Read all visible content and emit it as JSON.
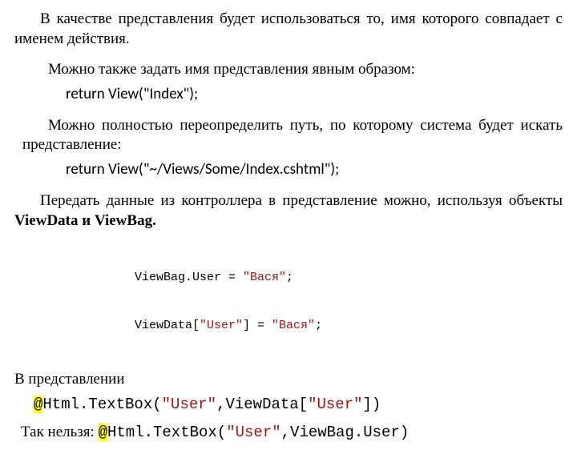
{
  "p1": "В качестве представления будет использоваться то, имя которого совпадает с именем действия.",
  "p2": "Можно также задать имя представления явным образом:",
  "c1_a": "return  View(",
  "c1_s": "\"Index\"",
  "c1_b": ");",
  "p3": "Можно полностью переопределить путь, по которому система будет искать представление:",
  "c2_a": "return View(",
  "c2_s": "\"~/Views/Some/Index.cshtml\"",
  "c2_b": ");",
  "p4_a": "Передать данные из контроллера в представление можно, используя объекты ",
  "p4_b": "ViewData и ViewBag.",
  "mb1_a": "ViewBag.User = ",
  "mb1_s": "\"Вася\"",
  "mb1_b": ";",
  "mb2_a": "ViewData[",
  "mb2_s1": "\"User\"",
  "mb2_b": "] = ",
  "mb2_s2": "\"Вася\"",
  "mb2_c": ";",
  "p5": "В представлении",
  "c3_at": "@",
  "c3_a": "Html.TextBox(",
  "c3_s1": "\"User\"",
  "c3_b": ",ViewData[",
  "c3_s2": "\"User\"",
  "c3_c": "])",
  "p6": "Так нельзя:   ",
  "c4_at": "@",
  "c4_a": "Html.TextBox(",
  "c4_s1": "\"User\"",
  "c4_b": ",ViewBag.User)"
}
